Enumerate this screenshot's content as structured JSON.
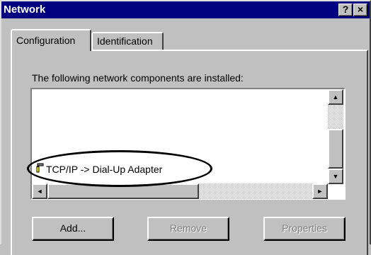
{
  "window": {
    "title": "Network",
    "help_button": "?",
    "close_button": "×"
  },
  "tabs": [
    {
      "label": "Configuration",
      "selected": true
    },
    {
      "label": "Identification",
      "selected": false
    }
  ],
  "components": {
    "label": "The following network components are installed:",
    "items": [
      {
        "label": "TCP/IP -> Dial-Up Adapter",
        "icon": "network-protocol-icon"
      }
    ]
  },
  "buttons": {
    "add": "Add...",
    "remove": "Remove",
    "properties": "Properties"
  },
  "scroll": {
    "up": "▲",
    "down": "▼",
    "left": "◄",
    "right": "►"
  }
}
